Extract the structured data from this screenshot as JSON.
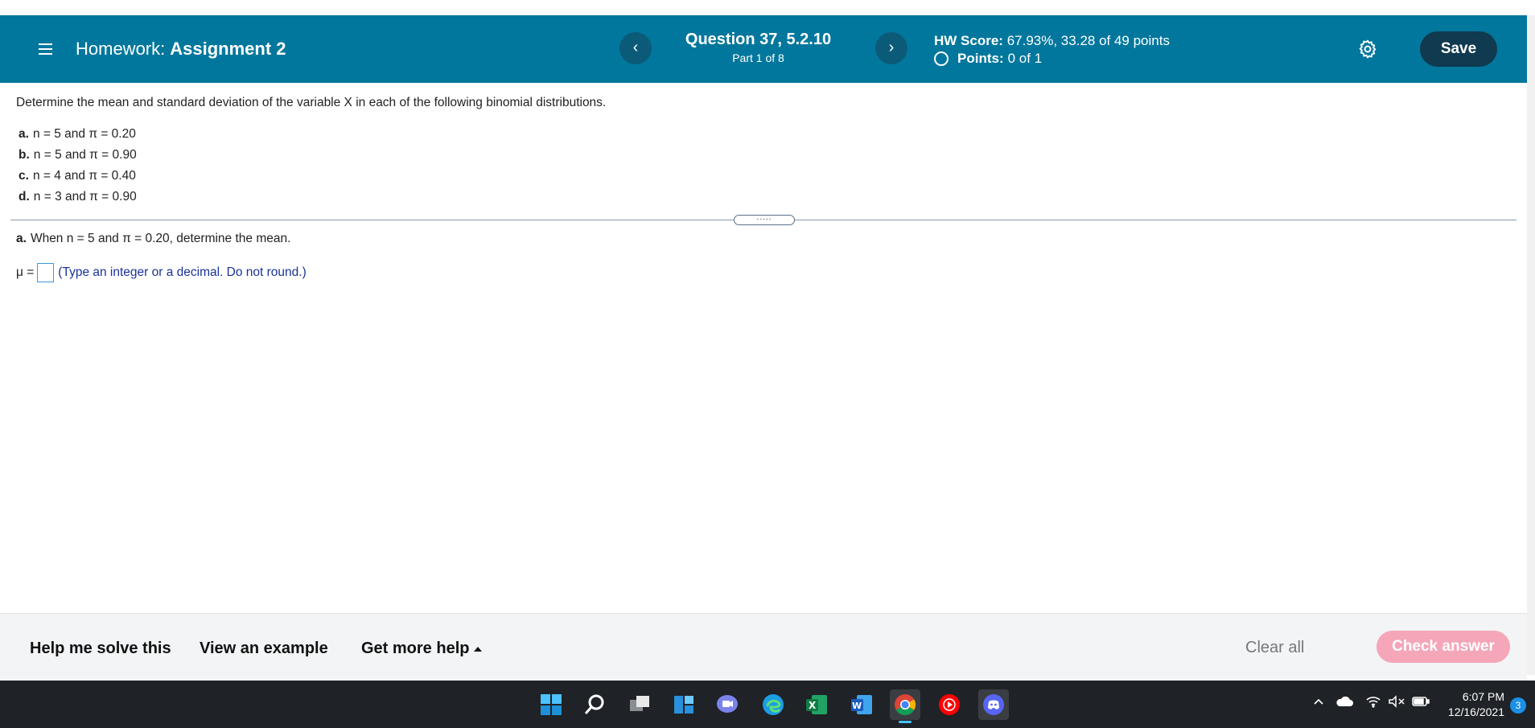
{
  "header": {
    "title_prefix": "Homework:",
    "title": "Assignment 2",
    "question_title": "Question 37, 5.2.10",
    "question_part": "Part 1 of 8",
    "prev_label": "‹",
    "next_label": "›",
    "hw_score_label": "HW Score:",
    "hw_score_value": "67.93%, 33.28 of 49 points",
    "points_label": "Points:",
    "points_value": "0 of 1",
    "save_label": "Save",
    "color": "#02779d"
  },
  "question": {
    "prompt": "Determine the mean and standard deviation of the variable X in each of the following binomial distributions.",
    "parts": [
      {
        "label": "a.",
        "text": "n = 5 and π = 0.20"
      },
      {
        "label": "b.",
        "text": "n = 5 and π = 0.90"
      },
      {
        "label": "c.",
        "text": "n = 4 and π = 0.40"
      },
      {
        "label": "d.",
        "text": "n = 3 and π = 0.90"
      }
    ],
    "handle_label": ".....",
    "sub_label": "a.",
    "sub_text": "When n = 5 and π = 0.20, determine the mean.",
    "answer_symbol": "μ =",
    "answer_value": "",
    "hint": "(Type an integer or a decimal. Do not round.)"
  },
  "footer": {
    "help_solve": "Help me solve this",
    "view_example": "View an example",
    "more_help": "Get more help",
    "clear_all": "Clear all",
    "check_answer": "Check answer"
  },
  "taskbar": {
    "icons": [
      "windows-start-icon",
      "search-icon",
      "task-view-icon",
      "widgets-icon",
      "teams-chat-icon",
      "edge-icon",
      "excel-icon",
      "word-icon",
      "chrome-icon",
      "youtube-music-icon",
      "discord-icon"
    ],
    "time": "6:07 PM",
    "date": "12/16/2021",
    "notification_count": "3"
  }
}
